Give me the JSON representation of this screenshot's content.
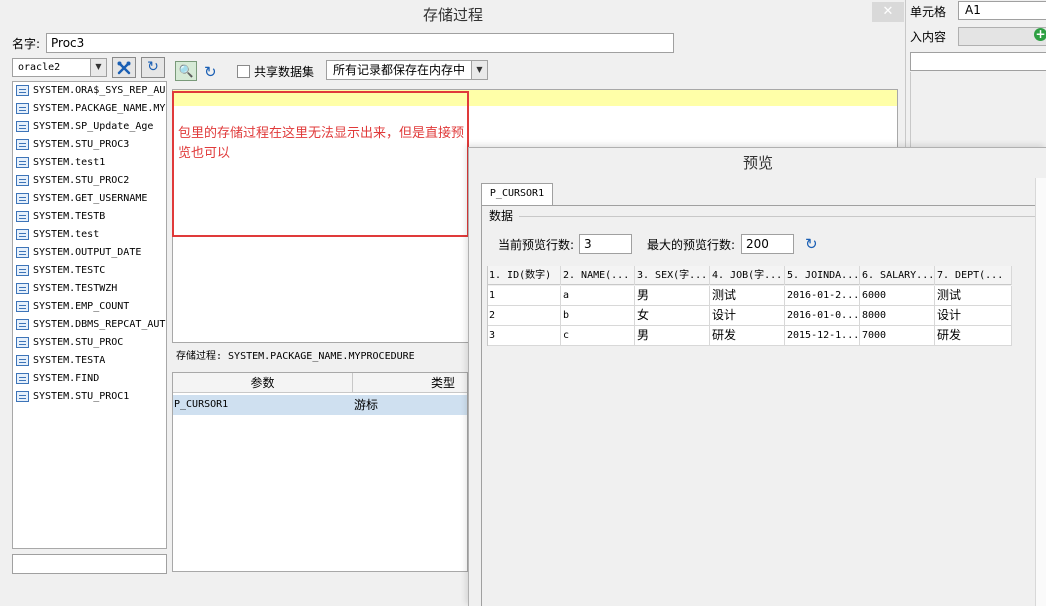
{
  "main": {
    "title": "存储过程",
    "close_label": "✕",
    "name_label": "名字:",
    "name_value": "Proc3",
    "datasource": "oracle2",
    "procedures": [
      "SYSTEM.ORA$_SYS_REP_AU",
      "SYSTEM.PACKAGE_NAME.MY",
      "SYSTEM.SP_Update_Age",
      "SYSTEM.STU_PROC3",
      "SYSTEM.test1",
      "SYSTEM.STU_PROC2",
      "SYSTEM.GET_USERNAME",
      "SYSTEM.TESTB",
      "SYSTEM.test",
      "SYSTEM.OUTPUT_DATE",
      "SYSTEM.TESTC",
      "SYSTEM.TESTWZH",
      "SYSTEM.EMP_COUNT",
      "SYSTEM.DBMS_REPCAT_AUT",
      "SYSTEM.STU_PROC",
      "SYSTEM.TESTA",
      "SYSTEM.FIND",
      "SYSTEM.STU_PROC1"
    ],
    "shared_dataset_label": "共享数据集",
    "memory_mode": "所有记录都保存在内存中",
    "annotation": "包里的存储过程在这里无法显示出来，但是直接预览也可以",
    "proc_line": "存储过程: SYSTEM.PACKAGE_NAME.MYPROCEDURE",
    "param_table": {
      "headers": [
        "参数",
        "类型"
      ],
      "rows": [
        {
          "name": "P_CURSOR1",
          "type": "游标"
        }
      ]
    }
  },
  "right_panel": {
    "cell_label": "单元格",
    "cell_value": "A1",
    "content_label": "入内容"
  },
  "preview": {
    "title": "预览",
    "tab": "P_CURSOR1",
    "data_group": "数据",
    "cur_rows_label": "当前预览行数:",
    "cur_rows_value": "3",
    "max_rows_label": "最大的预览行数:",
    "max_rows_value": "200",
    "columns": [
      "1. ID(数字)",
      "2. NAME(...",
      "3. SEX(字...",
      "4. JOB(字...",
      "5. JOINDA...",
      "6. SALARY...",
      "7. DEPT(..."
    ],
    "rows": [
      [
        "1",
        "a",
        "男",
        "测试",
        "2016-01-2...",
        "6000",
        "测试"
      ],
      [
        "2",
        "b",
        "女",
        "设计",
        "2016-01-0...",
        "8000",
        "设计"
      ],
      [
        "3",
        "c",
        "男",
        "研发",
        "2015-12-1...",
        "7000",
        "研发"
      ]
    ]
  }
}
